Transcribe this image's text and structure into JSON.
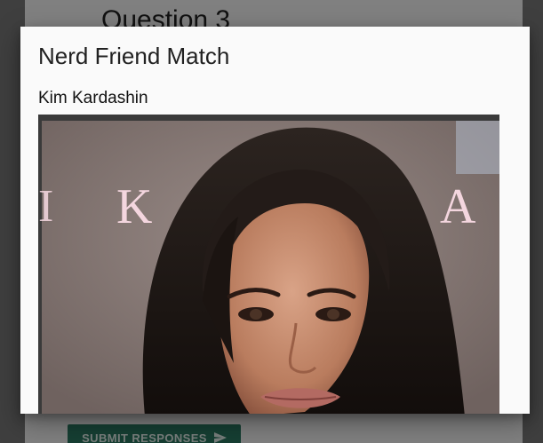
{
  "background": {
    "question_heading": "Question 3",
    "submit_label": "SUBMIT RESPONSES",
    "submit_icon": "send-icon"
  },
  "modal": {
    "title": "Nerd Friend Match",
    "match_name": "Kim Kardashin",
    "photo_backdrop_letters": [
      "K",
      "A"
    ]
  },
  "colors": {
    "modal_bg": "#fafafa",
    "submit_bg": "#2b7a63",
    "overlay": "rgba(0,0,0,0.48)"
  }
}
